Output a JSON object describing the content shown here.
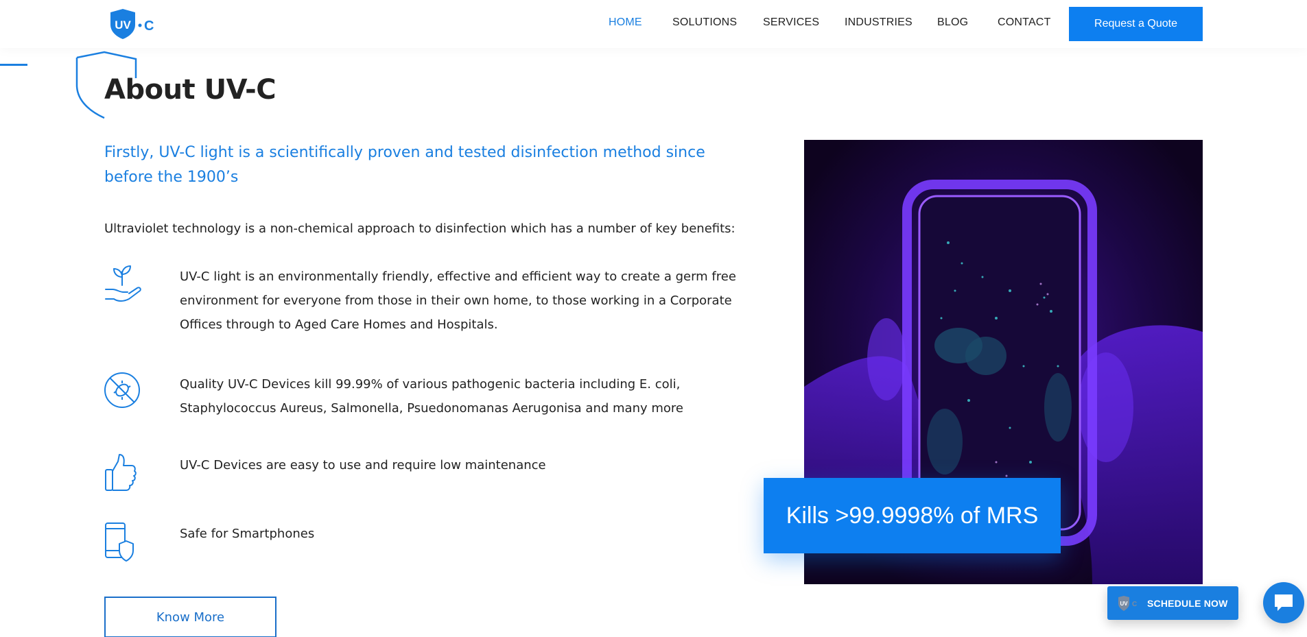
{
  "brand": {
    "logo_text": "UV·C",
    "accent": "#1a7fe0",
    "button_blue": "#0d7ff0"
  },
  "nav": {
    "items": [
      {
        "label": "HOME",
        "active": true
      },
      {
        "label": "SOLUTIONS",
        "active": false
      },
      {
        "label": "SERVICES",
        "active": false
      },
      {
        "label": "INDUSTRIES",
        "active": false
      },
      {
        "label": "BLOG",
        "active": false
      },
      {
        "label": "CONTACT",
        "active": false
      }
    ],
    "cta_label": "Request a Quote"
  },
  "about": {
    "title": "About UV-C",
    "lead": "Firstly, UV-C light is a scientifically proven and tested disinfection method since before the 1900’s",
    "intro": "Ultraviolet technology is a non-chemical approach to disinfection which has a number of key benefits:",
    "features": [
      {
        "icon": "plant-in-hand-icon",
        "text": "UV-C light is an environmentally friendly, effective and efficient way to create a germ free environment for everyone from those in their own home, to those working in a Corporate Offices through to Aged Care Homes and Hospitals."
      },
      {
        "icon": "no-bacteria-icon",
        "text": "Quality UV-C Devices kill 99.99% of various pathogenic bacteria including E. coli, Staphylococcus Aureus, Salmonella, Psuedonomanas Aerugonisa and many more"
      },
      {
        "icon": "thumbs-up-icon",
        "text": "UV-C Devices are easy to use and require low maintenance"
      },
      {
        "icon": "smartphone-shield-icon",
        "text": "Safe for Smartphones"
      }
    ],
    "know_more_label": "Know More"
  },
  "image": {
    "description_icon": "uv-lit-smartphone-photo",
    "badge": "Kills >99.9998% of MRS"
  },
  "widgets": {
    "schedule_label": "SCHEDULE NOW",
    "chat_icon": "chat-bubble-icon"
  }
}
